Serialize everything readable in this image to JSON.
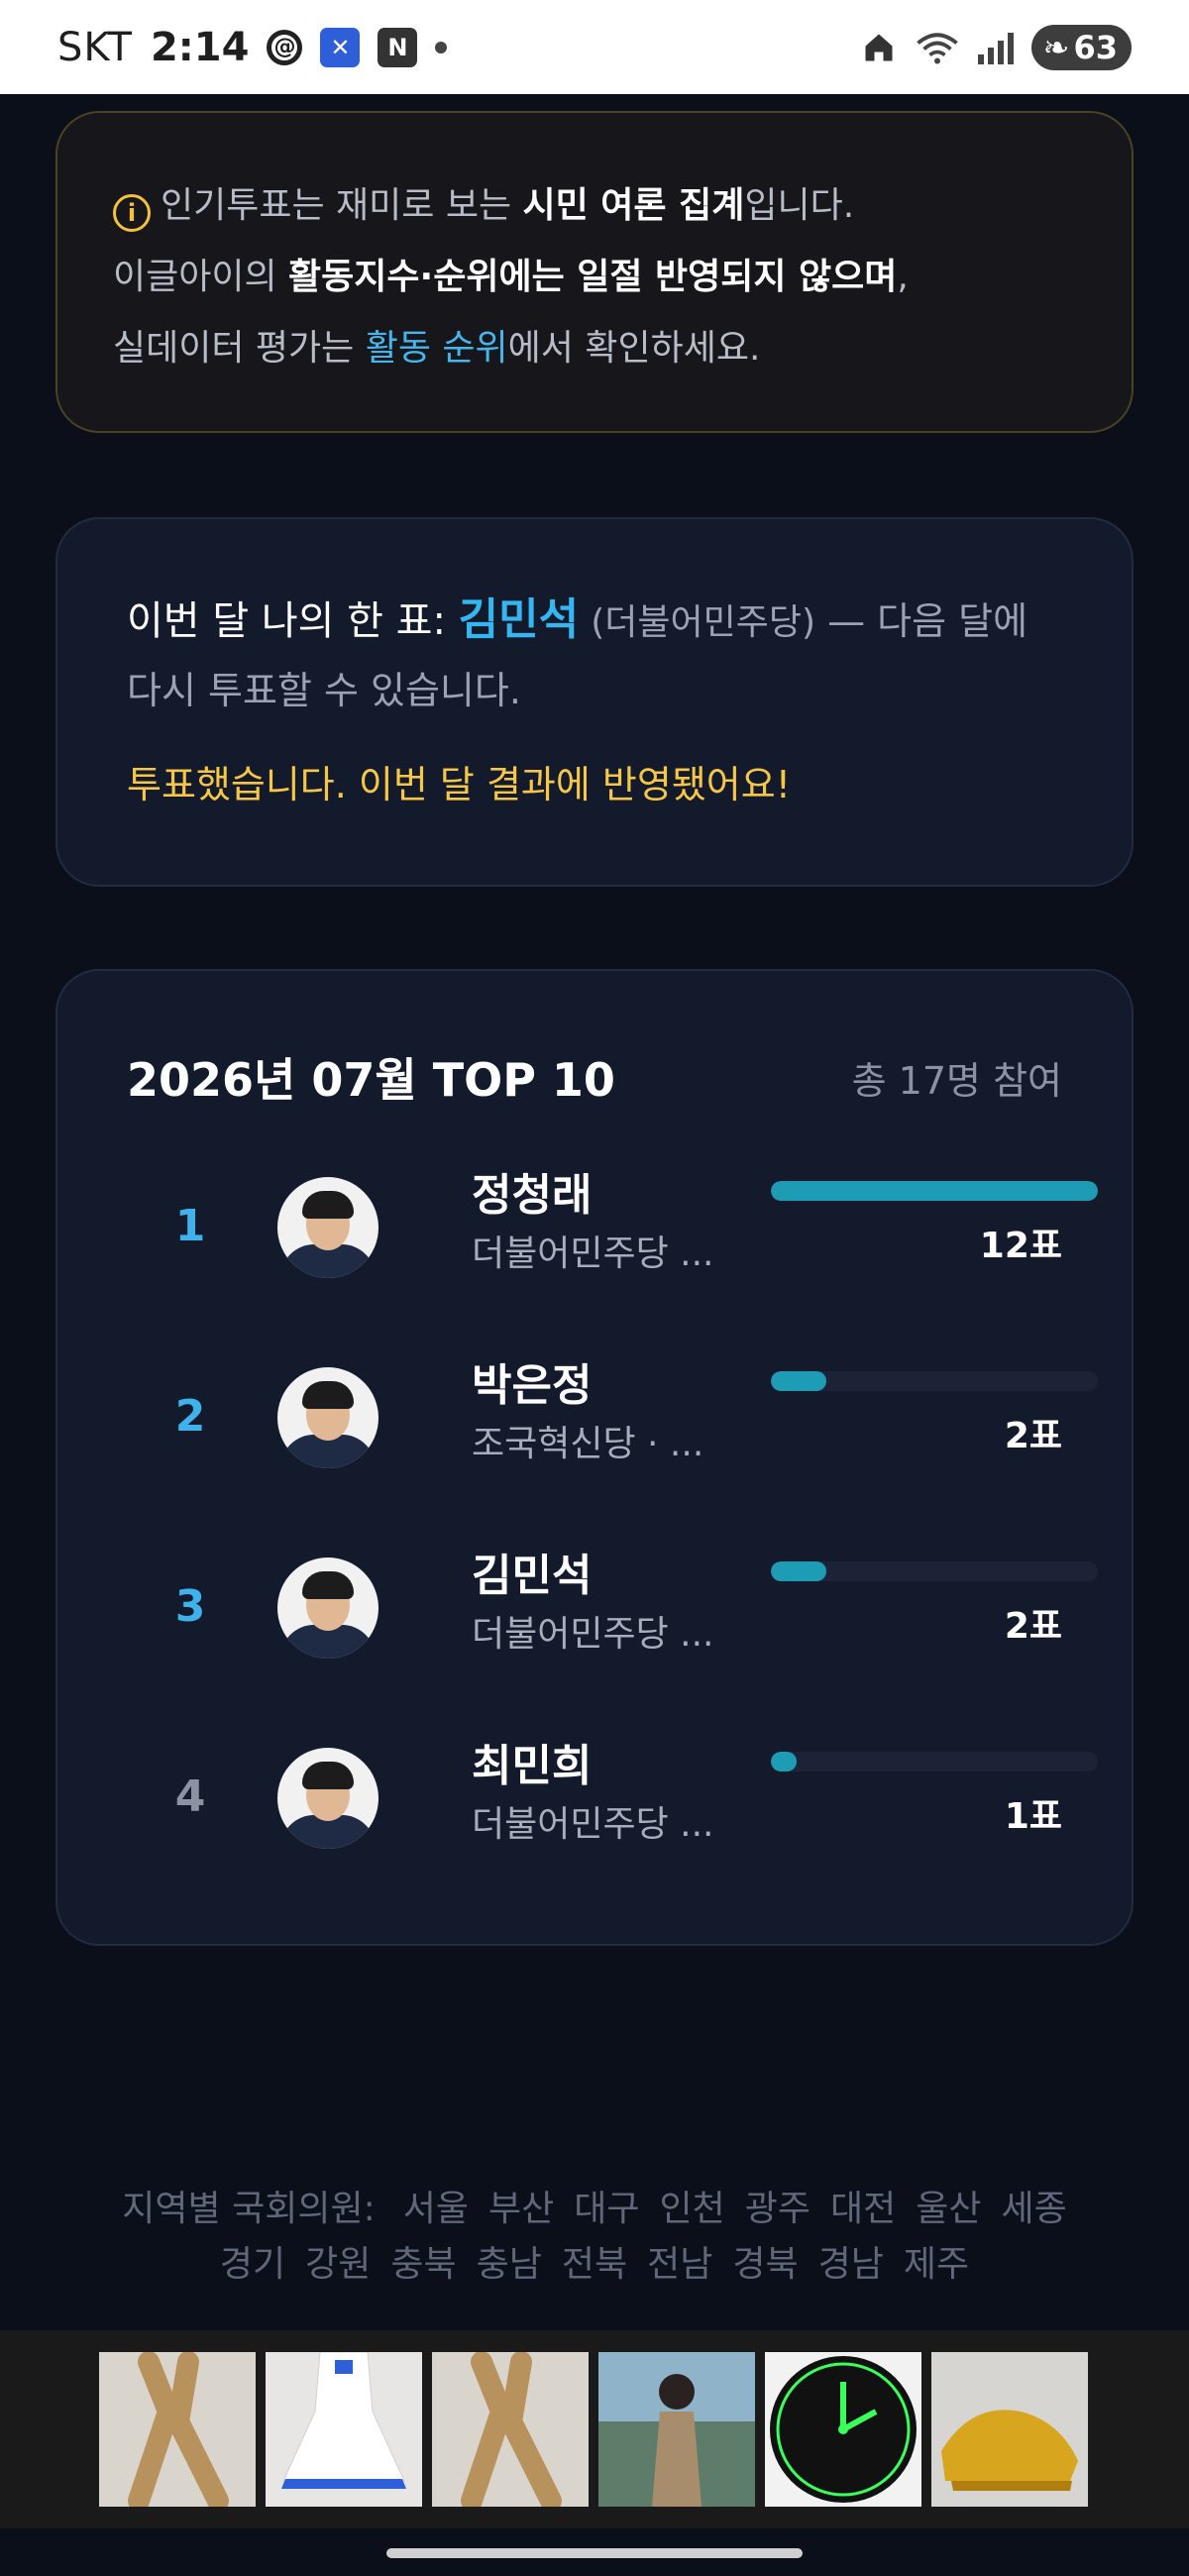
{
  "status_bar": {
    "carrier": "SKT",
    "time": "2:14",
    "app_icons": [
      "threads-icon",
      "x-icon",
      "n-icon"
    ],
    "battery": "63"
  },
  "notice": {
    "p1_a": "인기투표는 재미로 보는 ",
    "p1_b": "시민 여론 집계",
    "p1_c": "입니다.",
    "p2_a": "이글아이의 ",
    "p2_b": "활동지수·순위에는 일절 반영되지 않으며",
    "p2_c": ",",
    "p3_a": "실데이터 평가는 ",
    "p3_link": "활동 순위",
    "p3_c": "에서 확인하세요."
  },
  "my_vote": {
    "prefix": "이번 달 나의 한 표: ",
    "name": "김민석",
    "party": "(더불어민주당)",
    "suffix": " — 다음 달에",
    "line2": "다시 투표할 수 있습니다.",
    "done": "투표했습니다. 이번 달 결과에 반영됐어요!"
  },
  "ranking": {
    "title": "2026년 07월 TOP 10",
    "total": "총 17명 참여",
    "rows": [
      {
        "rank": "1",
        "name": "정청래",
        "party": "더불어민주당 ...",
        "votes": "12표",
        "share": 1.0
      },
      {
        "rank": "2",
        "name": "박은정",
        "party": "조국혁신당 · ...",
        "votes": "2표",
        "share": 0.17
      },
      {
        "rank": "3",
        "name": "김민석",
        "party": "더불어민주당 ...",
        "votes": "2표",
        "share": 0.17
      },
      {
        "rank": "4",
        "name": "최민희",
        "party": "더불어민주당 ...",
        "votes": "1표",
        "share": 0.08
      }
    ]
  },
  "regions": {
    "label": "지역별 국회의원:",
    "row1": [
      "서울",
      "부산",
      "대구",
      "인천",
      "광주",
      "대전",
      "울산",
      "세종"
    ],
    "row2": [
      "경기",
      "강원",
      "충북",
      "충남",
      "전북",
      "전남",
      "경북",
      "경남",
      "제주"
    ]
  },
  "colors": {
    "accent": "#35b6f0",
    "bar": "#1e9bb5",
    "warn": "#f6c746",
    "background": "#0b0f1a"
  }
}
